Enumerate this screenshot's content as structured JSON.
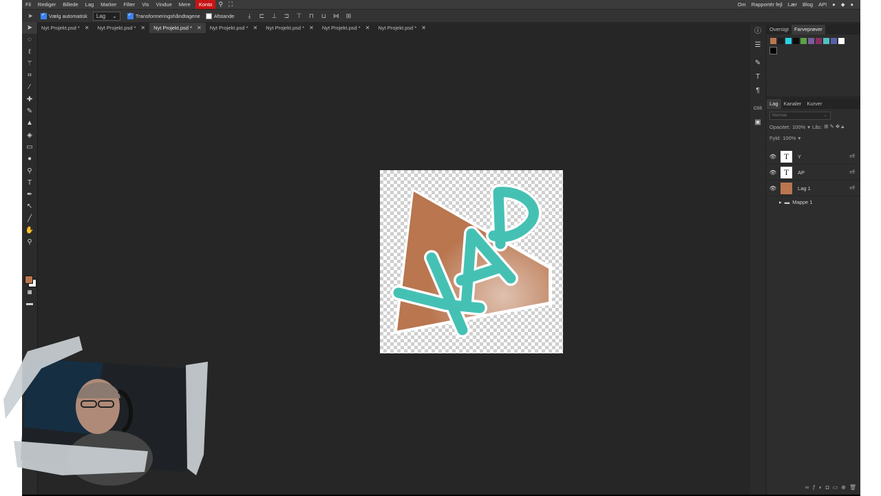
{
  "menu": {
    "items": [
      "Fil",
      "Rediger",
      "Billede",
      "Lag",
      "Marker",
      "Filter",
      "Vis",
      "Vindue",
      "Mere"
    ],
    "konto": "Konto",
    "right": [
      "Om",
      "Rapportér fejl",
      "Lær",
      "Blog",
      "API"
    ]
  },
  "options": {
    "auto_select": "Vælg automatisk",
    "auto_select_value": "Lag",
    "transform": "Transformeringshåndtagene",
    "distances": "Afstande"
  },
  "tabs": [
    {
      "label": "Nyt Projekt.psd *"
    },
    {
      "label": "Nyt Projekt.psd *"
    },
    {
      "label": "Nyt Projekt.psd *"
    },
    {
      "label": "Nyt Projekt.psd *"
    },
    {
      "label": "Nyt Projekt.psd *"
    },
    {
      "label": "Nyt Projekt.psd *"
    },
    {
      "label": "Nyt Projekt.psd *"
    }
  ],
  "active_tab_index": 2,
  "canvas": {
    "logo_text": "YAP",
    "colors": {
      "triangle": "#b9764f",
      "letters": "#45c1b4",
      "outline": "#ffffff"
    }
  },
  "swatch_panel": {
    "tabs": [
      "Oversigt",
      "Farveprøver"
    ],
    "colors": [
      "#b9764f",
      "#1c1c1c",
      "#29d3e6",
      "#0c0c0c",
      "#5ca144",
      "#7a5ca3",
      "#8a2f5f",
      "#4ec3be",
      "#5560a8",
      "#ffffff",
      "#000000"
    ]
  },
  "layers_panel": {
    "tabs": [
      "Lag",
      "Kanaler",
      "Kurver"
    ],
    "blend_mode": "Normal",
    "opacity_label": "Opacitet:",
    "opacity_value": "100%",
    "lock_label": "Lås:",
    "fill_label": "Fyld:",
    "fill_value": "100%",
    "layers": [
      {
        "name": "Y",
        "type": "text",
        "thumb": "T",
        "fx": "eff"
      },
      {
        "name": "AP",
        "type": "text",
        "thumb": "T",
        "fx": "eff"
      },
      {
        "name": "Lag 1",
        "type": "image",
        "thumb": "",
        "fx": "eff"
      }
    ],
    "folder": "Mappe 1"
  },
  "colors": {
    "foreground": "#b9764f",
    "background": "#ffffff",
    "accent": "#c81414"
  }
}
